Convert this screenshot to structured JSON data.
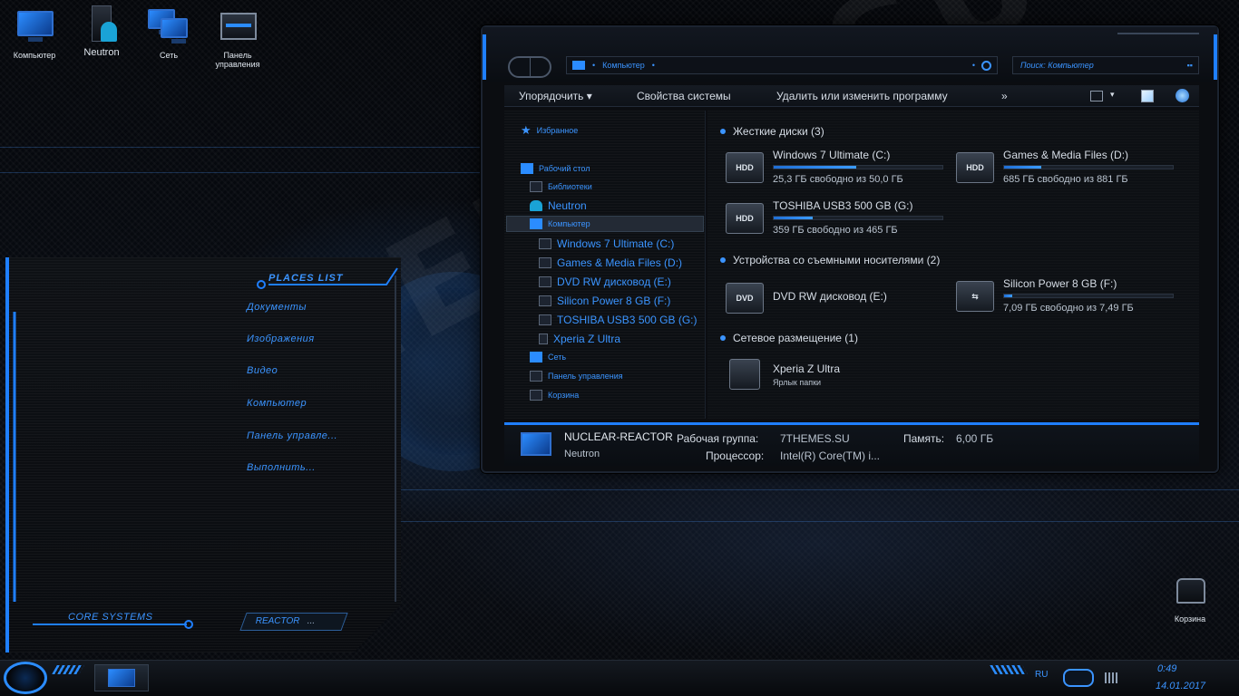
{
  "desktop": {
    "icons": [
      {
        "label": "Компьютер",
        "icon": "computer-icon"
      },
      {
        "label": "Neutron",
        "icon": "user-icon"
      },
      {
        "label": "Сеть",
        "icon": "network-icon"
      },
      {
        "label": "Панель управления",
        "icon": "control-panel-icon"
      },
      {
        "label": "Корзина",
        "icon": "recycle-bin-icon"
      }
    ],
    "watermark": "7THEMES.SU"
  },
  "places": {
    "title": "PLACES LIST",
    "items": [
      "Документы",
      "Изображения",
      "Видео",
      "Компьютер",
      "Панель управле...",
      "Выполнить..."
    ],
    "footer_label": "CORE SYSTEMS",
    "reactor_button": "REACTOR",
    "reactor_more": "..."
  },
  "explorer": {
    "address": "Компьютер",
    "search_placeholder": "Поиск: Компьютер",
    "toolbar": {
      "organize": "Упорядочить",
      "system_properties": "Свойства системы",
      "uninstall": "Удалить или изменить программу",
      "more": "»"
    },
    "nav": {
      "favorites": "Избранное",
      "desktop": "Рабочий стол",
      "libraries": "Библиотеки",
      "user": "Neutron",
      "computer": "Компьютер",
      "drives": [
        "Windows 7 Ultimate (C:)",
        "Games & Media Files (D:)",
        "DVD RW дисковод (E:)",
        "Silicon Power 8 GB (F:)",
        "TOSHIBA USB3 500 GB (G:)",
        "Xperia Z Ultra"
      ],
      "network": "Сеть",
      "control_panel": "Панель управления",
      "recycle_bin": "Корзина"
    },
    "groups": {
      "hdd": "Жесткие диски (3)",
      "removable": "Устройства со съемными носителями (2)",
      "network": "Сетевое размещение (1)"
    },
    "drives": [
      {
        "name": "Windows 7 Ultimate (C:)",
        "type": "HDD",
        "free": "25,3 ГБ свободно из 50,0 ГБ",
        "used_fraction": 0.49
      },
      {
        "name": "Games & Media Files (D:)",
        "type": "HDD",
        "free": "685 ГБ свободно из 881 ГБ",
        "used_fraction": 0.22
      },
      {
        "name": "TOSHIBA USB3 500 GB (G:)",
        "type": "HDD",
        "free": "359 ГБ свободно из 465 ГБ",
        "used_fraction": 0.23
      },
      {
        "name": "DVD RW дисковод (E:)",
        "type": "DVD"
      },
      {
        "name": "Silicon Power 8 GB (F:)",
        "type": "USB",
        "free": "7,09 ГБ свободно из 7,49 ГБ",
        "used_fraction": 0.05
      },
      {
        "name": "Xperia Z Ultra",
        "type": "phone",
        "subtitle": "Ярлык папки"
      }
    ],
    "status": {
      "computer_name": "NUCLEAR-REACTOR",
      "user": "Neutron",
      "workgroup_label": "Рабочая группа:",
      "workgroup": "7THEMES.SU",
      "memory_label": "Память:",
      "memory": "6,00 ГБ",
      "cpu_label": "Процессор:",
      "cpu": "Intel(R) Core(TM) i..."
    }
  },
  "taskbar": {
    "lang": "RU",
    "time": "0:49",
    "date": "14.01.2017"
  },
  "colors": {
    "accent": "#1f7fff",
    "accent_text": "#3b94ff",
    "background": "#05070b"
  }
}
